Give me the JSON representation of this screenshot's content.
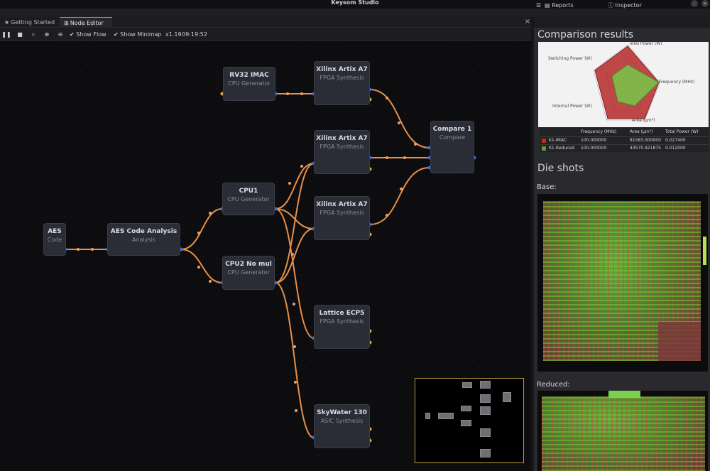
{
  "app": {
    "title": "Keysom Studio"
  },
  "tabs": [
    {
      "label": "Getting Started"
    },
    {
      "label": "Node Editor"
    }
  ],
  "toolbar": {
    "show_flow": "Show Flow",
    "show_minimap": "Show Minimap",
    "zoom": "x1.19",
    "time": "09:19:52"
  },
  "nodes": [
    {
      "title": "RV32 IMAC",
      "subtitle": "CPU Generator"
    },
    {
      "title": "Xilinx Artix A7",
      "subtitle": "FPGA Synthesis"
    },
    {
      "title": "Xilinx Artix A7",
      "subtitle": "FPGA Synthesis"
    },
    {
      "title": "Compare 1",
      "subtitle": "Compare"
    },
    {
      "title": "CPU1",
      "subtitle": "CPU Generator"
    },
    {
      "title": "Xilinx Artix A7",
      "subtitle": "FPGA Synthesis"
    },
    {
      "title": "AES",
      "subtitle": "Code"
    },
    {
      "title": "AES Code Analysis",
      "subtitle": "Analysis"
    },
    {
      "title": "CPU2 No mul",
      "subtitle": "CPU Generator"
    },
    {
      "title": "Lattice ECP5",
      "subtitle": "FPGA Synthesis"
    },
    {
      "title": "SkyWater 130",
      "subtitle": "ASIC Synthesis"
    }
  ],
  "right_panel": {
    "tabs": [
      {
        "label": "Reports"
      },
      {
        "label": "Inspector"
      }
    ],
    "comparison_title": "Comparison results",
    "radar_axes": [
      "Total Power (W)",
      "Frequency (MHz)",
      "Area (µm²)",
      "Internal Power (W)",
      "Switching Power (W)"
    ],
    "table": {
      "headers": [
        "Frequency (MHz)",
        "Area (µm²)",
        "Total Power (W)"
      ],
      "rows": [
        {
          "name": "K1-IMAC",
          "color": "#b52a2a",
          "values": [
            "100.000000",
            "81583.000000",
            "0.027400"
          ]
        },
        {
          "name": "K1-Reduced",
          "color": "#5aa02a",
          "values": [
            "100.000000",
            "43575.921875",
            "0.012000"
          ]
        }
      ]
    },
    "die_title": "Die shots",
    "base_label": "Base:",
    "reduced_label": "Reduced:"
  },
  "colors": {
    "accent": "#e07a2e",
    "wire": "#e8904a",
    "port_in": "#3d6fd6",
    "port_out": "#d4a84a"
  }
}
